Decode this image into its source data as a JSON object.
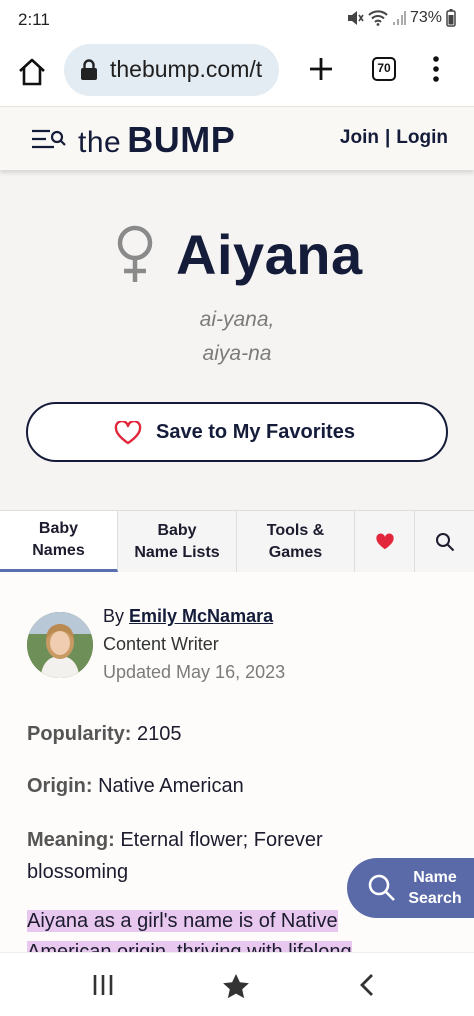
{
  "status_bar": {
    "time": "2:11",
    "battery": "73%",
    "icons": [
      "mute-icon",
      "wifi-icon",
      "signal-icon",
      "battery-icon"
    ]
  },
  "browser": {
    "url": "thebump.com/t",
    "tab_count": "70",
    "icons": [
      "home-icon",
      "lock-icon",
      "plus-icon",
      "tabs-icon",
      "overflow-menu-icon"
    ]
  },
  "site_header": {
    "logo_the": "the",
    "logo_bump": "BUMP",
    "join": "Join",
    "separator": "|",
    "login": "Login"
  },
  "hero": {
    "name": "Aiyana",
    "pronunciation_1": "ai-yana,",
    "pronunciation_2": "aiya-na",
    "favorite_label": "Save to My Favorites",
    "gender_icon": "female-icon"
  },
  "tabs": [
    {
      "line1": "Baby",
      "line2": "Names"
    },
    {
      "line1": "Baby",
      "line2": "Name Lists"
    },
    {
      "line1": "Tools &",
      "line2": "Games"
    }
  ],
  "author": {
    "by": "By",
    "name": "Emily McNamara",
    "role": "Content Writer",
    "updated": "Updated May 16, 2023"
  },
  "facts": {
    "popularity_label": "Popularity:",
    "popularity_value": "2105",
    "origin_label": "Origin:",
    "origin_value": "Native American",
    "meaning_label": "Meaning:",
    "meaning_value": "Eternal flower; Forever blossoming"
  },
  "description": "Aiyana as a girl's name is of Native American origin, thriving with lifelong",
  "name_search": {
    "line1": "Name",
    "line2": "Search"
  },
  "colors": {
    "brand_navy": "#141c3a",
    "accent_blue": "#5a6aa8",
    "heart_red": "#e2263b",
    "highlight": "#e8c8ef"
  }
}
